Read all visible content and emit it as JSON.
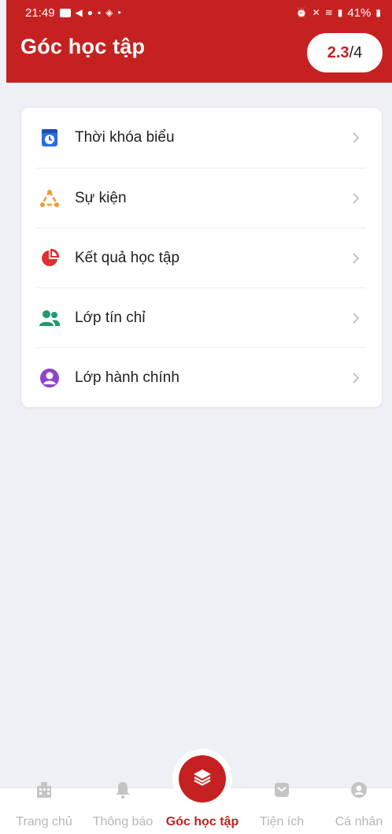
{
  "status_bar": {
    "time": "21:49",
    "battery": "41%"
  },
  "header": {
    "title": "Góc học tập",
    "gpa_value": "2.3",
    "gpa_max": "/4"
  },
  "menu": {
    "items": [
      {
        "label": "Thời khóa biểu",
        "icon": "calendar-clock-icon",
        "color": "#2d6cdf"
      },
      {
        "label": "Sự kiện",
        "icon": "event-triangle-icon",
        "color": "#f29d2a"
      },
      {
        "label": "Kết quả học tập",
        "icon": "pie-chart-icon",
        "color": "#e02f2f"
      },
      {
        "label": "Lớp tín chỉ",
        "icon": "group-users-icon",
        "color": "#1f9a6b"
      },
      {
        "label": "Lớp hành chính",
        "icon": "user-circle-icon",
        "color": "#8e44c7"
      }
    ]
  },
  "bottom_nav": {
    "items": [
      {
        "label": "Trang chủ",
        "icon": "building-icon",
        "active": false
      },
      {
        "label": "Thông báo",
        "icon": "bell-icon",
        "active": false
      },
      {
        "label": "Góc học tập",
        "icon": "layers-icon",
        "active": true
      },
      {
        "label": "Tiện ích",
        "icon": "box-icon",
        "active": false
      },
      {
        "label": "Cá nhân",
        "icon": "person-icon",
        "active": false
      }
    ]
  },
  "colors": {
    "brand": "#c62121",
    "background": "#eef0f5",
    "inactive": "#b6b6b6"
  }
}
